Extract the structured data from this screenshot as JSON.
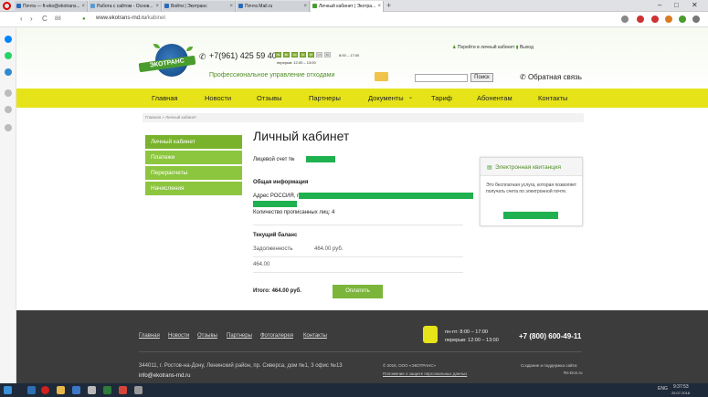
{
  "browser": {
    "tabs": [
      {
        "label": "Почта — ft-eko@ekotrans...",
        "favicon_color": "#2a6ab8",
        "active": false
      },
      {
        "label": "Работа с сайтом - Основ...",
        "favicon_color": "#5b9bd5",
        "active": false
      },
      {
        "label": "Войти | Экотранс",
        "favicon_color": "#2a6ab8",
        "active": false
      },
      {
        "label": "Почта Mail.ru",
        "favicon_color": "#2a6ab8",
        "active": false
      },
      {
        "label": "Личный кабинет | Экотра...",
        "favicon_color": "#4a9c2e",
        "active": true
      }
    ],
    "new_tab": "+",
    "url_host": "www.ekotrans-rnd.ru",
    "url_path": "/kabinet",
    "speed_dial": "88"
  },
  "header": {
    "logo_text": "ЭКОТРАНС",
    "phone": "+7(961) 425 59 40",
    "days": [
      "Пн",
      "Вт",
      "Ср",
      "Чт",
      "Пт",
      "Сб",
      "Вс"
    ],
    "hours": "8:00 – 17:00",
    "break": "перерыв: 12:00 – 13:00",
    "tagline": "Профессиональное управление отходами",
    "cabinet_link": "Перейти в личный кабинет",
    "exit_link": "Выход",
    "search_button": "Поиск",
    "search_value": "",
    "feedback": "Обратная связь"
  },
  "nav": [
    "Главная",
    "Новости",
    "Отзывы",
    "Партнеры",
    "Документы",
    "Тариф",
    "Абонентам",
    "Контакты"
  ],
  "breadcrumb": {
    "home": "Главная",
    "sep": " » ",
    "current": "Личный кабинет"
  },
  "side_menu": [
    "Личный кабинет",
    "Платежи",
    "Перерасчеты",
    "Начисления"
  ],
  "content": {
    "title": "Личный кабинет",
    "account_label": "Лицевой счет №",
    "general_info": "Общая информация",
    "address_label": "Адрес РОССИЯ, г",
    "residents_label": "Количество прописанных лиц: 4",
    "balance_title": "Текущий баланс",
    "debt_label": "Задолженность",
    "debt_value": "464.00 руб.",
    "debt_amount": "464.00",
    "total": "Итого: 464.00 руб.",
    "pay_button": "Оплатить"
  },
  "receipt": {
    "title": "Электронная квитанция",
    "text": "Это бесплатная услуга, которая позволяет получать счета по электронной почте."
  },
  "footer": {
    "nav": [
      "Главная",
      "Новости",
      "Отзывы",
      "Партнеры",
      "Фотогалерея",
      "Контакты"
    ],
    "schedule": "пн-пт: 8:00 – 17:00",
    "break": "перерыв: 12:00 – 13:00",
    "phone": "+7 (800) 600-49-11",
    "address": "344011, г. Ростов-на-Дону, Ленинский район, пр. Сиверса, дом №1, 3 офис №13",
    "email": "info@ekotrans-rnd.ru",
    "copyright": "© 2018, ООО «ЭКОТРАНС»",
    "privacy": "Положение о защите персональных данных",
    "dev1": "Создание и поддержка сайта:",
    "dev2": "Rs-Don.ru"
  },
  "taskbar": {
    "lang": "ENG",
    "time": "9:37:53",
    "date": "25.07.2018"
  },
  "colors": {
    "accent_green": "#8cc63f",
    "nav_yellow": "#e6e419",
    "footer_dark": "#3c3c3c",
    "redaction": "#1fb04f"
  }
}
